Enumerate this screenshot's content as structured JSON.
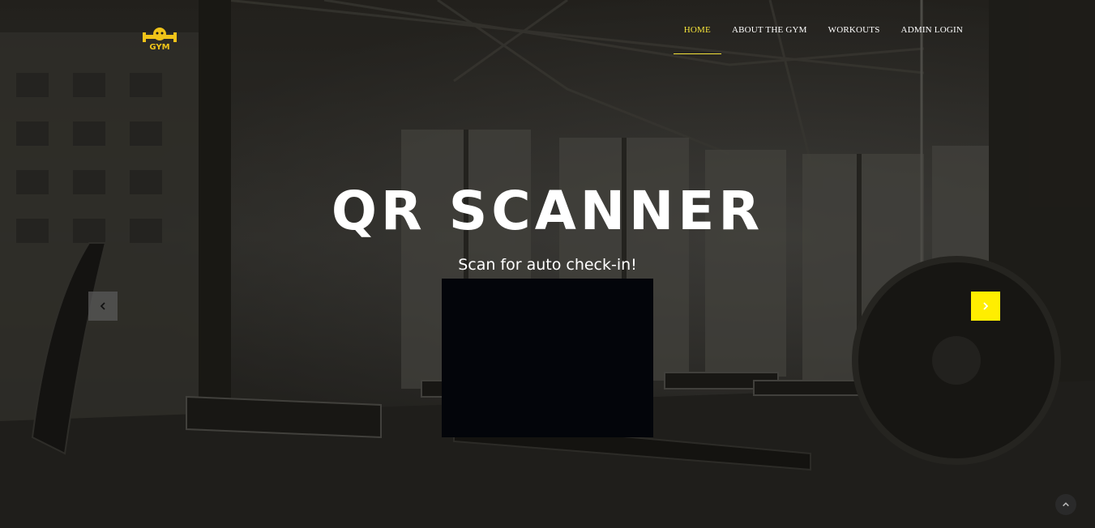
{
  "brand": {
    "logo_text": "GYM",
    "logo_color": "#f0c419"
  },
  "nav": {
    "items": [
      {
        "label": "HOME",
        "active": true
      },
      {
        "label": "ABOUT THE GYM",
        "active": false
      },
      {
        "label": "WORKOUTS",
        "active": false
      },
      {
        "label": "ADMIN LOGIN",
        "active": false
      }
    ],
    "active_color": "#f5e33a"
  },
  "hero": {
    "title": "QR SCANNER",
    "subtitle": "Scan for auto check-in!",
    "prev_icon": "chevron-left-icon",
    "next_icon": "chevron-right-icon",
    "next_button_color": "#ffee00"
  },
  "scroll_top_icon": "chevron-up-icon"
}
